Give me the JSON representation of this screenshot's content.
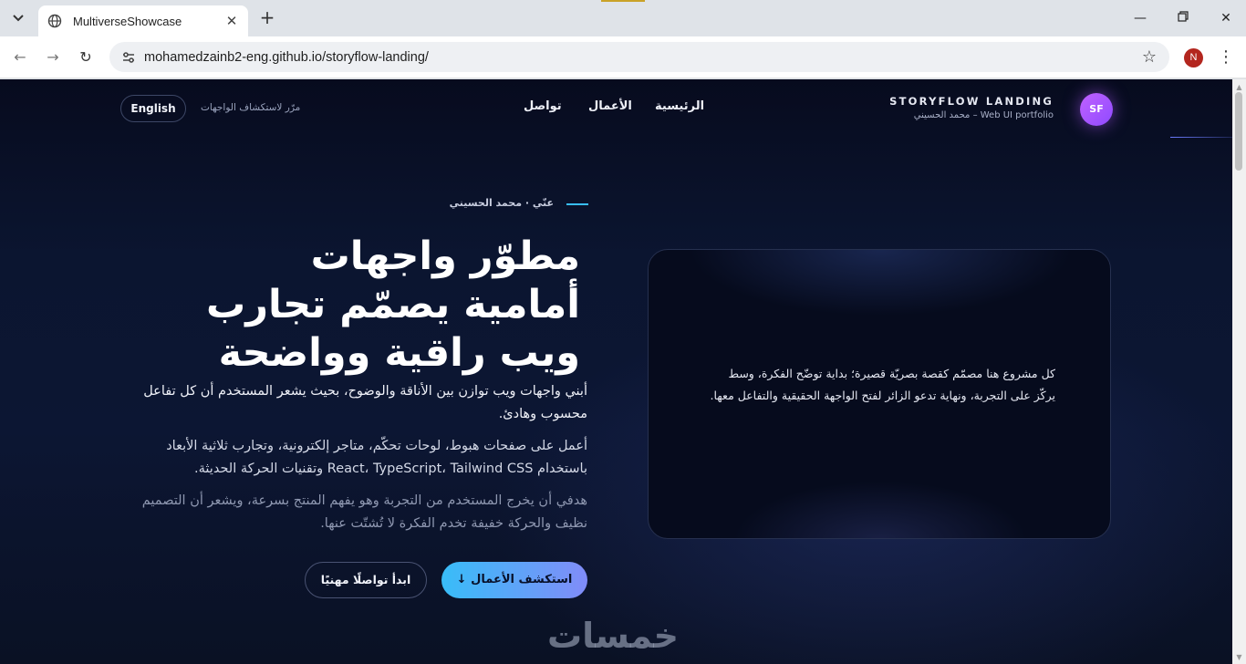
{
  "browser": {
    "tab_title": "MultiverseShowcase",
    "url": "mohamedzainb2-eng.github.io/storyflow-landing/",
    "profile_initial": "N",
    "icons": [
      "tab-search-icon",
      "globe-icon",
      "close-icon",
      "plus-icon",
      "minimize-icon",
      "restore-icon",
      "window-close-icon",
      "back-icon",
      "forward-icon",
      "reload-icon",
      "site-settings-icon",
      "star-icon",
      "kebab-menu-icon"
    ]
  },
  "header": {
    "avatar_initials": "SF",
    "brand_title": "STORYFLOW LANDING",
    "brand_subtitle": "Web UI portfolio – محمد الحسيني",
    "nav": [
      "الرئيسية",
      "الأعمال",
      "تواصل"
    ],
    "hint": "مرّر لاستكشاف الواجهات",
    "lang_button": "English"
  },
  "hero": {
    "eyebrow": "عنّي · محمد الحسيني",
    "title": "مطوّر واجهات أمامية يصمّم تجارب ويب راقية وواضحة",
    "p1": "أبني واجهات ويب توازن بين الأناقة والوضوح، بحيث يشعر المستخدم أن كل تفاعل محسوب وهادئ.",
    "p2": "أعمل على صفحات هبوط، لوحات تحكّم، متاجر إلكترونية، وتجارب ثلاثية الأبعاد باستخدام React، TypeScript، Tailwind CSS وتقنيات الحركة الحديثة.",
    "p3": "هدفي أن يخرج المستخدم من التجربة وهو يفهم المنتج بسرعة، ويشعر أن التصميم نظيف والحركة خفيفة تخدم الفكرة لا تُشتّت عنها.",
    "primary_button": "استكشف الأعمال ↓",
    "secondary_button": "ابدأ تواصلًا مهنيًا"
  },
  "card": {
    "text": "كل مشروع هنا مصمّم كقصة بصريّة قصيرة؛ بداية توضّح الفكرة، وسط يركّز على التجربة، ونهاية تدعو الزائر لفتح الواجهة الحقيقية والتفاعل معها."
  },
  "watermark": "خمسات",
  "colors": {
    "accent_cyan": "#38bdf8",
    "accent_indigo": "#818cf8",
    "avatar_purple": "#a855f7",
    "background": "#0b1530"
  }
}
